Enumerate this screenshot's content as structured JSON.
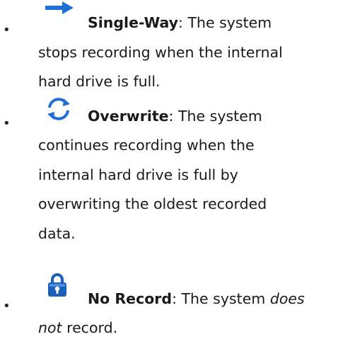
{
  "list": {
    "items": [
      {
        "icon": "right-arrow-icon",
        "term": "Single-Way",
        "sep": ":",
        "line1": " The system",
        "line2": "stops recording when the internal",
        "line3": "hard drive is full."
      },
      {
        "icon": "refresh-cycle-icon",
        "term": "Overwrite",
        "sep": ":",
        "line1": " The system",
        "line2": "continues recording when the",
        "line3": "internal hard drive is full by",
        "line4": "overwriting the oldest recorded",
        "line5": "data."
      },
      {
        "icon": "lock-icon",
        "term": "No Record",
        "sep": ":",
        "line1a": " The system ",
        "line1b": "does",
        "line2a": "not",
        "line2b": " record."
      }
    ],
    "bullet": "•",
    "colors": {
      "icon_blue": "#1f6fd6",
      "lock_blue": "#1b5fb8",
      "text": "#1a1a1a"
    }
  }
}
